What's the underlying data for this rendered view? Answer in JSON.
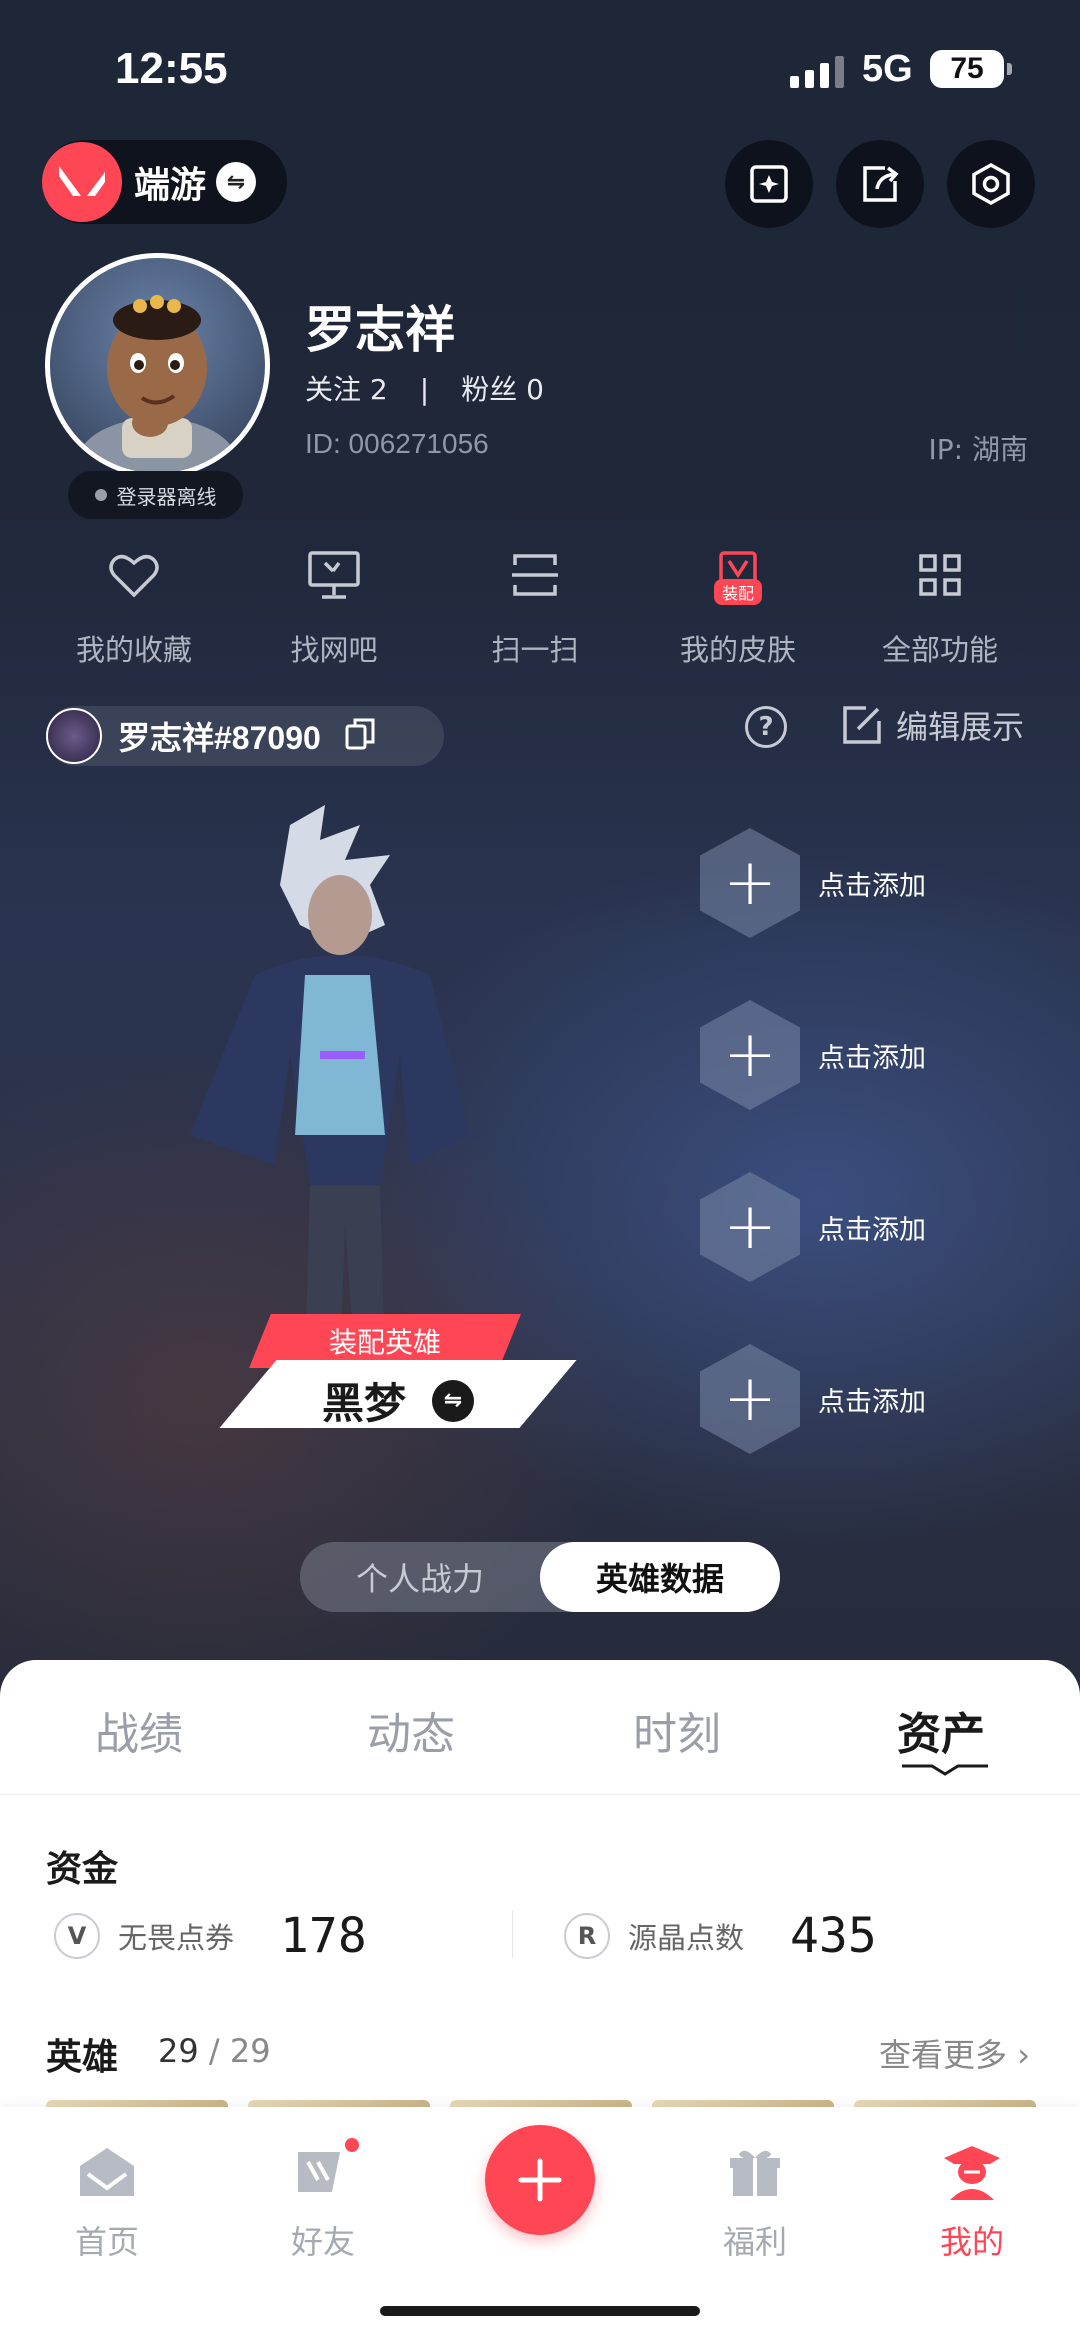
{
  "status_bar": {
    "time": "12:55",
    "network": "5G",
    "battery": "75"
  },
  "header": {
    "game_name": "端游",
    "icons": [
      "sparkle-card-icon",
      "share-icon",
      "settings-hex-icon"
    ]
  },
  "profile": {
    "username": "罗志祥",
    "following_label": "关注",
    "following_count": "2",
    "fans_label": "粉丝",
    "fans_count": "0",
    "separator": "|",
    "id_text": "ID: 006271056",
    "ip_text": "IP: 湖南",
    "login_status": "登录器离线"
  },
  "shortcuts": [
    {
      "label": "我的收藏",
      "icon": "heart-icon"
    },
    {
      "label": "找网吧",
      "icon": "monitor-icon"
    },
    {
      "label": "扫一扫",
      "icon": "scan-icon"
    },
    {
      "label": "我的皮肤",
      "icon": "skin-icon",
      "badge": "装配"
    },
    {
      "label": "全部功能",
      "icon": "grid-icon"
    }
  ],
  "riot": {
    "riot_id": "罗志祥#87090",
    "edit_label": "编辑展示",
    "help": "?"
  },
  "hero": {
    "equip_label": "装配英雄",
    "name": "黑梦"
  },
  "add_slots": [
    "点击添加",
    "点击添加",
    "点击添加",
    "点击添加"
  ],
  "segmented": {
    "options": [
      "个人战力",
      "英雄数据"
    ],
    "selected": "英雄数据"
  },
  "tabs": {
    "items": [
      "战绩",
      "动态",
      "时刻",
      "资产"
    ],
    "active": "资产"
  },
  "funds": {
    "title": "资金",
    "items": [
      {
        "name": "无畏点券",
        "value": "178",
        "icon_char": "V"
      },
      {
        "name": "源晶点数",
        "value": "435",
        "icon_char": "R"
      }
    ]
  },
  "heroes": {
    "title": "英雄",
    "owned": "29",
    "total_text": "/ 29",
    "see_more": "查看更多"
  },
  "bottom_nav": {
    "items": [
      "首页",
      "好友",
      "福利",
      "我的"
    ],
    "active": "我的"
  },
  "colors": {
    "accent": "#ff4655",
    "bg_dark": "#1e2738",
    "panel": "#ffffff"
  }
}
